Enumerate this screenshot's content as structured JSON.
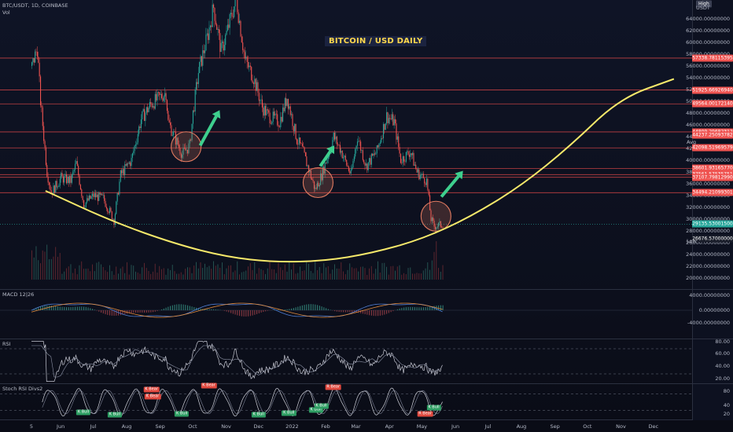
{
  "header": {
    "symbol": "BTC/USDT, 1D, COINBASE",
    "vol_label": "Vol",
    "high_label": "High",
    "currency": "USDT",
    "avg_label": "Avg",
    "low_label": "Low"
  },
  "annotation_title": "BITCOIN / USD DAILY",
  "price_ticks": [
    "64000.00000000",
    "62000.00000000",
    "60000.00000000",
    "58000.00000000",
    "56000.00000000",
    "54000.00000000",
    "52000.00000000",
    "50000.00000000",
    "48000.00000000",
    "46000.00000000",
    "44000.00000000",
    "42000.00000000",
    "40000.00000000",
    "38000.00000000",
    "36000.00000000",
    "34000.00000000",
    "32000.00000000",
    "30000.00000000",
    "28000.00000000",
    "26000.00000000",
    "24000.00000000",
    "22000.00000000",
    "20000.00000000"
  ],
  "price_tags": [
    {
      "label": "57338.78115395",
      "value": 57338.78,
      "color": "#ef5350"
    },
    {
      "label": "51925.66926940",
      "value": 51925.67,
      "color": "#ef5350"
    },
    {
      "label": "49564.00172140",
      "value": 49564.0,
      "color": "#ef5350"
    },
    {
      "label": "44809.29682312",
      "value": 44809.3,
      "color": "#ef5350"
    },
    {
      "label": "44237.25093782",
      "value": 44237.25,
      "color": "#ef5350"
    },
    {
      "label": "42098.51969579",
      "value": 42098.52,
      "color": "#ef5350"
    },
    {
      "label": "38601.93165770",
      "value": 38601.93,
      "color": "#ef5350"
    },
    {
      "label": "37561.57535751",
      "value": 37561.58,
      "color": "#ef5350"
    },
    {
      "label": "37107.79812990",
      "value": 37107.8,
      "color": "#ef5350"
    },
    {
      "label": "34494.21099301",
      "value": 34494.21,
      "color": "#ef5350"
    },
    {
      "label": "29135.53001500",
      "value": 29135.53,
      "color": "#26a69a"
    },
    {
      "label": "26676.57000000",
      "value": 26676.57,
      "color": "#1a1e2b"
    }
  ],
  "macd": {
    "label": "MACD 12|26",
    "ticks": [
      "4000.00000000",
      "0.00000000",
      "-4000.00000000"
    ]
  },
  "rsi": {
    "label": "RSI",
    "ticks": [
      "80.00",
      "60.00",
      "40.00",
      "20.00"
    ]
  },
  "stoch": {
    "label": "Stoch RSI Divs2",
    "ticks": [
      "80",
      "40",
      "20"
    ],
    "badges": [
      {
        "text": "K Bull",
        "type": "bull",
        "x_date": "2021-06-22",
        "y": 12
      },
      {
        "text": "K Bull",
        "type": "bull",
        "x_date": "2021-07-21",
        "y": 4
      },
      {
        "text": "K Bear",
        "type": "bear",
        "x_date": "2021-08-24",
        "y": 96
      },
      {
        "text": "K Bear",
        "type": "bear",
        "x_date": "2021-08-25",
        "y": 70
      },
      {
        "text": "K Bull",
        "type": "bull",
        "x_date": "2021-09-21",
        "y": 8
      },
      {
        "text": "K Bear",
        "type": "bear",
        "x_date": "2021-10-16",
        "y": 108
      },
      {
        "text": "K Bull",
        "type": "bull",
        "x_date": "2021-12-01",
        "y": 4
      },
      {
        "text": "K Bull",
        "type": "bull",
        "x_date": "2021-12-29",
        "y": 10
      },
      {
        "text": "K Bull",
        "type": "bull",
        "x_date": "2022-01-23",
        "y": 22
      },
      {
        "text": "K Bull",
        "type": "bull",
        "x_date": "2022-01-28",
        "y": 36
      },
      {
        "text": "R Bear",
        "type": "bear",
        "x_date": "2022-02-08",
        "y": 104
      },
      {
        "text": "R Bear",
        "type": "bear",
        "x_date": "2022-05-04",
        "y": 8
      },
      {
        "text": "K Bull",
        "type": "bull",
        "x_date": "2022-05-12",
        "y": 30
      }
    ]
  },
  "time_labels": [
    "5",
    "Jun",
    "Jul",
    "Aug",
    "Sep",
    "Oct",
    "Nov",
    "Dec",
    "2022",
    "Feb",
    "Mar",
    "Apr",
    "May",
    "Jun",
    "Jul",
    "Aug",
    "Sep",
    "Oct",
    "Nov",
    "Dec"
  ],
  "colors": {
    "up": "#26a69a",
    "down": "#ef5350",
    "curve": "#f5e86a",
    "circle": "#e07a60",
    "arrow": "#3ecf8e",
    "hline": "#e04848"
  },
  "chart_data": {
    "type": "candlestick",
    "title": "BITCOIN / USD DAILY",
    "symbol": "BTC/USDT, 1D, COINBASE",
    "x_range": [
      "2021-05-05",
      "2022-12-31"
    ],
    "ylim": [
      19000,
      66000
    ],
    "horizontal_levels": [
      57338.78,
      51925.67,
      49564.0,
      44809.3,
      42098.52,
      38601.93,
      37561.58,
      37107.8,
      34494.21
    ],
    "average": 44237.25,
    "last_price": 29135.53,
    "low": 26676.57,
    "high": 69000,
    "price_path": [
      {
        "date": "2021-05-05",
        "close": 56000
      },
      {
        "date": "2021-05-10",
        "close": 59000
      },
      {
        "date": "2021-05-13",
        "close": 50000
      },
      {
        "date": "2021-05-19",
        "close": 38000
      },
      {
        "date": "2021-05-23",
        "close": 34500
      },
      {
        "date": "2021-06-01",
        "close": 37000
      },
      {
        "date": "2021-06-10",
        "close": 36500
      },
      {
        "date": "2021-06-15",
        "close": 39500
      },
      {
        "date": "2021-06-22",
        "close": 32500
      },
      {
        "date": "2021-07-01",
        "close": 34000
      },
      {
        "date": "2021-07-10",
        "close": 33500
      },
      {
        "date": "2021-07-20",
        "close": 29800
      },
      {
        "date": "2021-07-26",
        "close": 37500
      },
      {
        "date": "2021-08-05",
        "close": 40000
      },
      {
        "date": "2021-08-14",
        "close": 47000
      },
      {
        "date": "2021-08-23",
        "close": 49500
      },
      {
        "date": "2021-09-06",
        "close": 51500
      },
      {
        "date": "2021-09-08",
        "close": 46500
      },
      {
        "date": "2021-09-21",
        "close": 41000
      },
      {
        "date": "2021-09-28",
        "close": 42500
      },
      {
        "date": "2021-10-01",
        "close": 48000
      },
      {
        "date": "2021-10-06",
        "close": 55000
      },
      {
        "date": "2021-10-15",
        "close": 61500
      },
      {
        "date": "2021-10-20",
        "close": 66000
      },
      {
        "date": "2021-10-27",
        "close": 58500
      },
      {
        "date": "2021-11-01",
        "close": 61500
      },
      {
        "date": "2021-11-10",
        "close": 67500
      },
      {
        "date": "2021-11-18",
        "close": 57000
      },
      {
        "date": "2021-11-26",
        "close": 54000
      },
      {
        "date": "2021-12-04",
        "close": 49000
      },
      {
        "date": "2021-12-10",
        "close": 47500
      },
      {
        "date": "2021-12-20",
        "close": 46500
      },
      {
        "date": "2021-12-27",
        "close": 50700
      },
      {
        "date": "2022-01-05",
        "close": 43500
      },
      {
        "date": "2022-01-10",
        "close": 41800
      },
      {
        "date": "2022-01-22",
        "close": 35000
      },
      {
        "date": "2022-01-28",
        "close": 37500
      },
      {
        "date": "2022-02-08",
        "close": 44000
      },
      {
        "date": "2022-02-14",
        "close": 42000
      },
      {
        "date": "2022-02-24",
        "close": 37500
      },
      {
        "date": "2022-03-02",
        "close": 44000
      },
      {
        "date": "2022-03-10",
        "close": 39000
      },
      {
        "date": "2022-03-20",
        "close": 41500
      },
      {
        "date": "2022-03-29",
        "close": 47500
      },
      {
        "date": "2022-04-05",
        "close": 46500
      },
      {
        "date": "2022-04-11",
        "close": 40000
      },
      {
        "date": "2022-04-20",
        "close": 41500
      },
      {
        "date": "2022-04-26",
        "close": 38000
      },
      {
        "date": "2022-05-05",
        "close": 36500
      },
      {
        "date": "2022-05-09",
        "close": 30000
      },
      {
        "date": "2022-05-12",
        "close": 28800
      },
      {
        "date": "2022-05-20",
        "close": 29135
      }
    ],
    "curve_points": [
      {
        "date": "2021-05-18",
        "value": 34800
      },
      {
        "date": "2021-07-20",
        "value": 29500
      },
      {
        "date": "2021-09-15",
        "value": 25800
      },
      {
        "date": "2021-11-01",
        "value": 23600
      },
      {
        "date": "2021-12-15",
        "value": 22700
      },
      {
        "date": "2022-01-31",
        "value": 22900
      },
      {
        "date": "2022-03-15",
        "value": 24200
      },
      {
        "date": "2022-05-01",
        "value": 26600
      },
      {
        "date": "2022-06-15",
        "value": 30400
      },
      {
        "date": "2022-08-01",
        "value": 35700
      },
      {
        "date": "2022-09-15",
        "value": 42400
      },
      {
        "date": "2022-10-31",
        "value": 50500
      },
      {
        "date": "2022-12-20",
        "value": 53800
      }
    ],
    "circles": [
      {
        "date": "2021-09-25",
        "value": 42300
      },
      {
        "date": "2022-01-25",
        "value": 36200
      },
      {
        "date": "2022-05-14",
        "value": 30500
      }
    ],
    "arrows": [
      {
        "from_date": "2021-10-08",
        "from_value": 42500,
        "to_date": "2021-10-26",
        "to_value": 48500
      },
      {
        "from_date": "2022-01-27",
        "from_value": 39000,
        "to_date": "2022-02-09",
        "to_value": 42500
      },
      {
        "from_date": "2022-05-19",
        "from_value": 33800,
        "to_date": "2022-06-08",
        "to_value": 38200
      }
    ],
    "series": [
      {
        "name": "MACD 12|26",
        "ylim": [
          -6000,
          6000
        ]
      },
      {
        "name": "RSI",
        "ylim": [
          15,
          85
        ],
        "levels": [
          70,
          30
        ]
      },
      {
        "name": "Stoch RSI Divs2",
        "ylim": [
          -15,
          115
        ],
        "levels": [
          80,
          20
        ]
      }
    ]
  }
}
